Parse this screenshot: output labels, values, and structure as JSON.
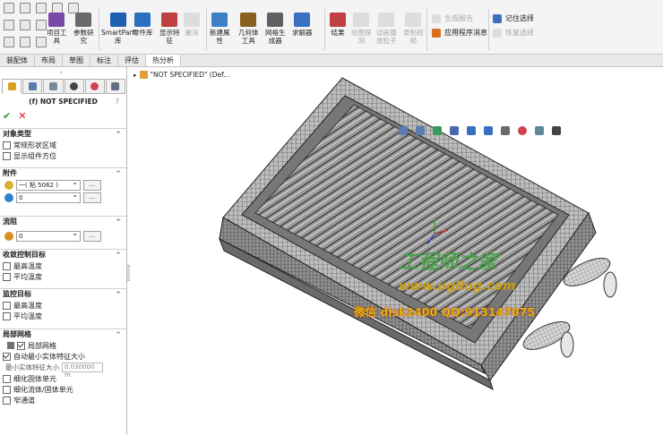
{
  "ribbon": {
    "buttons": [
      {
        "label": "项目工\n具",
        "color": "#7a4aa8"
      },
      {
        "label": "参数研\n究",
        "color": "#6a6a6a"
      },
      {
        "label": "SmartPart\n库",
        "color": "#2060b0"
      },
      {
        "label": "零件库",
        "color": "#2a70c0"
      },
      {
        "label": "显示特\n征",
        "color": "#c04040"
      },
      {
        "label": "新建属\n性",
        "color": "#3c80c8"
      },
      {
        "label": "几何体\n工具",
        "color": "#8a6020"
      },
      {
        "label": "网格生\n成器",
        "color": "#606060"
      },
      {
        "label": "求解器",
        "color": "#3a70c0"
      },
      {
        "label": "结果",
        "color": "#c04040"
      },
      {
        "label": "绘图探\n测",
        "color": "#999"
      },
      {
        "label": "动画播\n放粒子",
        "color": "#999"
      },
      {
        "label": "录制视\n频",
        "color": "#999"
      }
    ],
    "disabled_extra": "撤消",
    "report_label": "生成报告",
    "app_msg_label": "应用程序消息",
    "remember_label": "记住选择",
    "restore_label": "恢复选择"
  },
  "tabs": [
    "装配体",
    "布局",
    "草图",
    "标注",
    "评估",
    "热分析"
  ],
  "panel": {
    "title": "(f) NOT SPECIFIED",
    "help": "?",
    "ok": "✔",
    "cancel": "✕",
    "sections": {
      "object_type": {
        "title": "对象类型",
        "items": [
          "常规形状区域",
          "显示组件方位"
        ]
      },
      "attachment": {
        "title": "附件",
        "dd1": "一( 粘 5062 )",
        "dd2": "0",
        "btn": "..."
      },
      "flow": {
        "title": "流阻",
        "dd1": "0",
        "btn": "..."
      },
      "convergence": {
        "title": "收敛控制目标",
        "items": [
          "最高温度",
          "平均温度"
        ]
      },
      "monitor": {
        "title": "监控目标",
        "items": [
          "最高温度",
          "平均温度"
        ]
      },
      "local_mesh": {
        "title": "局部网格",
        "local_mesh_cb": "局部网格",
        "auto_min": "自动最小实体特征大小",
        "min_size_label": "最小实体特征大小",
        "min_size_value": "0.030000 m",
        "items": [
          "细化固体单元",
          "细化流体/固体单元",
          "窄通道"
        ]
      }
    }
  },
  "view": {
    "tree_label": "\"NOT SPECIFIED\" (Def...",
    "watermark1": "工程师之家",
    "watermark2": "www.ug8ug.com",
    "watermark3": "微信 disk2400  QQ:913147075"
  }
}
